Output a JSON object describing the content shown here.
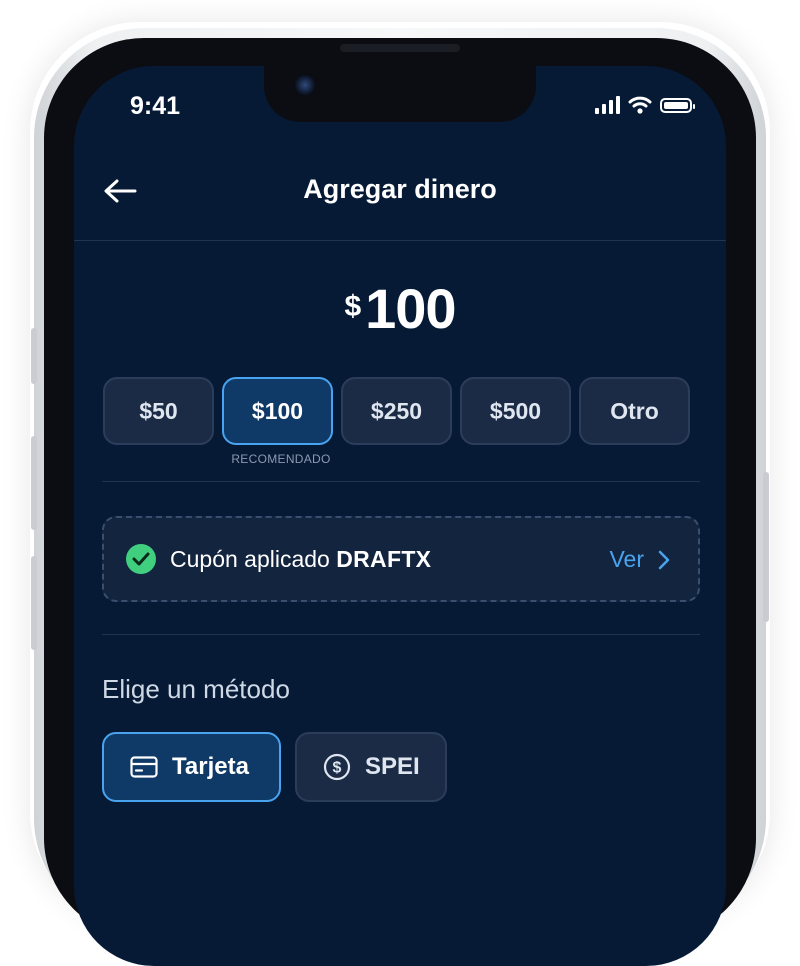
{
  "status_bar": {
    "time": "9:41"
  },
  "header": {
    "title": "Agregar dinero",
    "back_icon": "arrow-left-icon"
  },
  "amount": {
    "currency_symbol": "$",
    "value": "100"
  },
  "amount_options": [
    {
      "label": "$50",
      "selected": false
    },
    {
      "label": "$100",
      "selected": true
    },
    {
      "label": "$250",
      "selected": false
    },
    {
      "label": "$500",
      "selected": false
    },
    {
      "label": "Otro",
      "selected": false
    }
  ],
  "recommended_label": "RECOMENDADO",
  "coupon": {
    "prefix": "Cupón aplicado",
    "code": "DRAFTX",
    "action_label": "Ver",
    "icon": "check-circle-icon"
  },
  "payment": {
    "section_title": "Elige un método",
    "methods": [
      {
        "label": "Tarjeta",
        "icon": "credit-card-icon",
        "selected": true
      },
      {
        "label": "SPEI",
        "icon": "dollar-circle-icon",
        "selected": false
      }
    ]
  },
  "colors": {
    "background": "#061a35",
    "accent": "#4aa3ee",
    "chip": "#1b2b46",
    "chip_selected": "#0f3966",
    "success": "#3fcf7f"
  }
}
